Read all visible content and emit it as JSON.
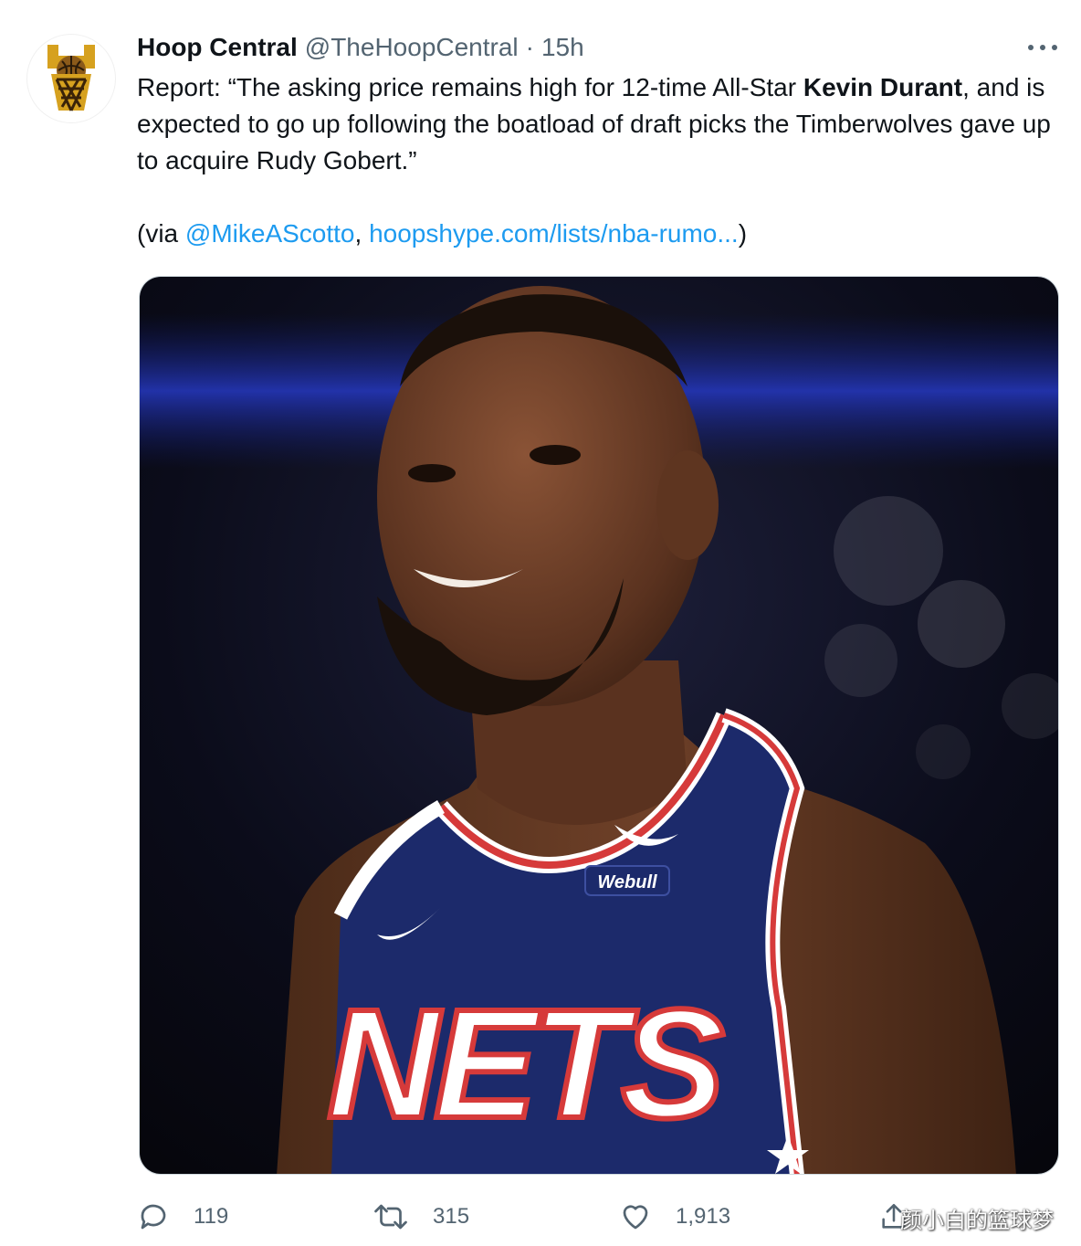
{
  "author": {
    "display_name": "Hoop Central",
    "handle": "@TheHoopCentral",
    "separator": "·",
    "time": "15h",
    "avatar_icon": "basketball-hoop-logo-icon"
  },
  "tweet": {
    "text_before": "Report: “The asking price remains high for 12-time All-Star ",
    "text_bold": "Kevin Durant",
    "text_after": ", and is expected to go up following the boatload of draft picks the Timberwolves gave up to acquire Rudy Gobert.”",
    "via_prefix": "(via ",
    "mention": "@MikeAScotto",
    "comma": ", ",
    "url": "hoopshype.com/lists/nba-rumo...",
    "via_suffix": ")"
  },
  "media": {
    "jersey_text": "NETS",
    "sponsor": "Webull"
  },
  "actions": {
    "reply_count": "119",
    "retweet_count": "315",
    "like_count": "1,913"
  },
  "watermark": "颜小白的篮球梦",
  "colors": {
    "link": "#1d9bf0",
    "secondary_text": "#536471",
    "logo_gold": "#d6a11f",
    "jersey_navy": "#1c2a6b",
    "jersey_red": "#d63a3a"
  }
}
